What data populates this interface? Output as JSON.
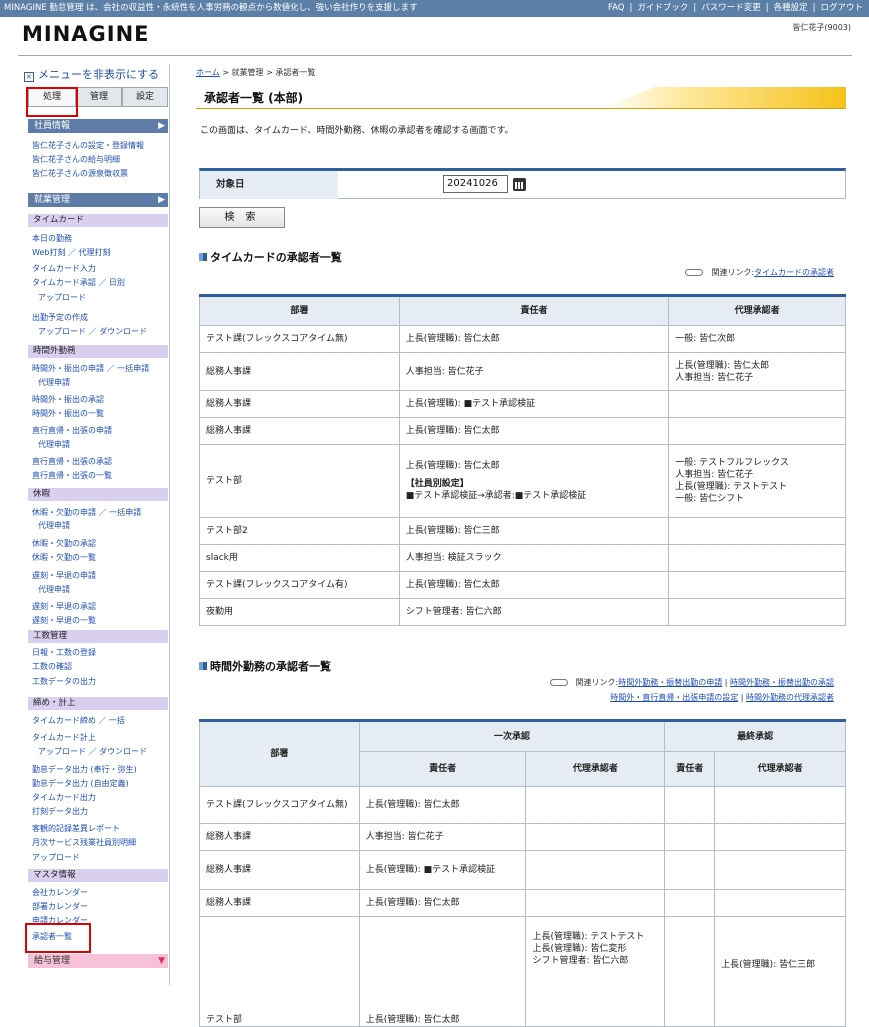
{
  "topbar": {
    "tagline": "MINAGINE 勤怠管理 は、会社の収益性・永続性を人事労務の観点から数値化し、強い会社作りを支援します",
    "links": [
      "FAQ",
      "ガイドブック",
      "パスワード変更",
      "各種設定",
      "ログアウト"
    ]
  },
  "logo": "MINAGINE",
  "user": "皆仁花子(9003)",
  "sidebar": {
    "toggle": "メニューを非表示にする",
    "tabs": [
      "処理",
      "管理",
      "設定"
    ],
    "headers": {
      "employee": "社員情報",
      "attendance": "就業管理",
      "salary": "給与管理"
    },
    "employee_links": [
      "皆仁花子さんの設定・登録情報",
      "皆仁花子さんの給与明細",
      "皆仁花子さんの源泉徴収票"
    ],
    "subs": {
      "timecard": "タイムカード",
      "overtime": "時間外勤務",
      "holiday": "休暇",
      "workhours": "工数管理",
      "closing": "締め・計上",
      "master": "マスタ情報"
    },
    "timecard_links": [
      "本日の勤務",
      "Web打刻 ／ 代理打刻",
      "タイムカード入力",
      "タイムカード承認 ／ 日別",
      "アップロード",
      "出勤予定の作成",
      "アップロード ／ ダウンロード"
    ],
    "overtime_links": [
      "時間外・振出の申請 ／ 一括申請",
      "代理申請",
      "時間外・振出の承認",
      "時間外・振出の一覧",
      "直行直帰・出張の申請",
      "代理申請",
      "直行直帰・出張の承認",
      "直行直帰・出張の一覧"
    ],
    "holiday_links": [
      "休暇・欠勤の申請 ／ 一括申請",
      "代理申請",
      "休暇・欠勤の承認",
      "休暇・欠勤の一覧",
      "遅刻・早退の申請",
      "代理申請",
      "遅刻・早退の承認",
      "遅刻・早退の一覧"
    ],
    "workhours_links": [
      "日報・工数の登録",
      "工数の確認",
      "工数データの出力"
    ],
    "closing_links": [
      "タイムカード締め ／ 一括",
      "タイムカード計上",
      "アップロード ／ ダウンロード",
      "勤怠データ出力 (奉行・弥生)",
      "勤怠データ出力 (自由定義)",
      "タイムカード出力",
      "打刻データ出力",
      "客観的記録差異レポート",
      "月次サービス残業社員別明細",
      "アップロード"
    ],
    "master_links": [
      "会社カレンダー",
      "部署カレンダー",
      "申請カレンダー",
      "承認者一覧"
    ]
  },
  "breadcrumb": {
    "home": "ホーム",
    "sep": ">",
    "items": [
      "就業管理",
      "承認者一覧"
    ]
  },
  "page_title": "承認者一覧 (本部)",
  "description": "この画面は、タイムカード、時間外勤務、休暇の承認者を確認する画面です。",
  "search": {
    "label": "対象日",
    "date_value": "20241026",
    "button": "検 索"
  },
  "section1": {
    "title": "タイムカードの承認者一覧",
    "related_prefix": "関連リンク:",
    "related_link": "タイムカードの承認者",
    "headers": [
      "部署",
      "責任者",
      "代理承認者"
    ],
    "rows": [
      {
        "dept": "テスト課(フレックスコアタイム無)",
        "mgr": "上長(管理職): 皆仁太郎",
        "mgr2": "",
        "mgr3": "",
        "proxy": [
          "一般: 皆仁次郎"
        ]
      },
      {
        "dept": "総務人事課",
        "mgr": "人事担当: 皆仁花子",
        "mgr2": "",
        "mgr3": "",
        "proxy": [
          "上長(管理職): 皆仁太郎",
          "人事担当: 皆仁花子"
        ]
      },
      {
        "dept": "総務人事課",
        "mgr": "上長(管理職): ■テスト承認検証",
        "mgr2": "",
        "mgr3": "",
        "proxy": []
      },
      {
        "dept": "総務人事課",
        "mgr": "上長(管理職): 皆仁太郎",
        "mgr2": "",
        "mgr3": "",
        "proxy": []
      },
      {
        "dept": "テスト部",
        "mgr": "上長(管理職): 皆仁太郎",
        "mgr2": "【社員別設定】",
        "mgr3": "■テスト承認検証→承認者:■テスト承認検証",
        "proxy": [
          "一般: テストフルフレックス",
          "人事担当: 皆仁花子",
          "上長(管理職): テストテスト",
          "一般: 皆仁シフト"
        ]
      },
      {
        "dept": "テスト部2",
        "mgr": "上長(管理職): 皆仁三郎",
        "mgr2": "",
        "mgr3": "",
        "proxy": []
      },
      {
        "dept": "slack用",
        "mgr": "人事担当: 検証スラック",
        "mgr2": "",
        "mgr3": "",
        "proxy": []
      },
      {
        "dept": "テスト課(フレックスコアタイム有)",
        "mgr": "上長(管理職): 皆仁太郎",
        "mgr2": "",
        "mgr3": "",
        "proxy": []
      },
      {
        "dept": "夜勤用",
        "mgr": "シフト管理者: 皆仁六郎",
        "mgr2": "",
        "mgr3": "",
        "proxy": []
      }
    ]
  },
  "section2": {
    "title": "時間外勤務の承認者一覧",
    "related_prefix": "関連リンク:",
    "related_links": [
      "時間外勤務・振替出勤の申請",
      "時間外勤務・振替出勤の承認",
      "時間外・直行直帰・出張申請の設定",
      "時間外勤務の代理承認者"
    ],
    "headers": {
      "dept": "部署",
      "first": "一次承認",
      "final": "最終承認",
      "mgr": "責任者",
      "proxy": "代理承認者",
      "final_mgr": "責任者"
    },
    "rows": [
      {
        "dept": "テスト課(フレックスコアタイム無)",
        "mgr": "上長(管理職): 皆仁太郎",
        "proxy": [],
        "fmgr": "",
        "fproxy": ""
      },
      {
        "dept": "総務人事課",
        "mgr": "人事担当: 皆仁花子",
        "proxy": [],
        "fmgr": "",
        "fproxy": ""
      },
      {
        "dept": "総務人事課",
        "mgr": "上長(管理職): ■テスト承認検証",
        "proxy": [],
        "fmgr": "",
        "fproxy": ""
      },
      {
        "dept": "総務人事課",
        "mgr": "上長(管理職): 皆仁太郎",
        "proxy": [],
        "fmgr": "",
        "fproxy": ""
      },
      {
        "dept": "テスト部",
        "mgr": "上長(管理職): 皆仁太郎",
        "proxy": [
          "上長(管理職): テストテスト",
          "上長(管理職): 皆仁変形",
          "シフト管理者: 皆仁六郎"
        ],
        "fmgr": "",
        "fproxy": "上長(管理職): 皆仁三郎"
      }
    ]
  },
  "colors": {
    "topbar": "#5b7fa6",
    "accent": "#2e5f9c",
    "highlight": "#e00000"
  }
}
